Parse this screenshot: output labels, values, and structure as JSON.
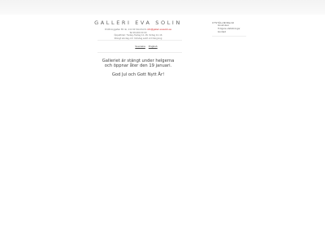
{
  "header": {
    "title": "GALLERI EVA SOLIN",
    "address_line": "Drottninggatan 85 nb, 111 60 Stockholm",
    "email": "info@galleri-evasolin.se",
    "phone_line": "Tel 08-000 00 00",
    "hours_line": "Öppettider: Tisdag–fredag 12–18, lördag 12–16",
    "footer_line": "Stängt söndag och måndag samt vid hängning"
  },
  "menu": {
    "heading": "UTSTÄLLNINGAR",
    "items": [
      "Konstnärer",
      "Tidigare utställningar",
      "Kontakt"
    ]
  },
  "nav": {
    "items": [
      "Svenska",
      "English"
    ]
  },
  "notice": {
    "line1": "Galleriet är stängt under helgerna",
    "line2": "och öppnar åter den 19 januari."
  },
  "greeting": "God Jul och Gott Nytt År!"
}
